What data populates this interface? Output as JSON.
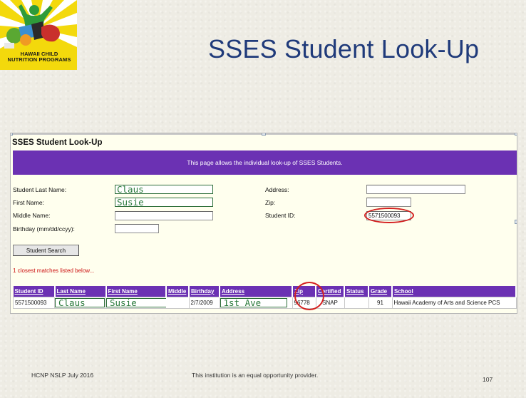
{
  "logo": {
    "line1": "HAWAII CHILD",
    "line2": "NUTRITION PROGRAMS",
    "colors": {
      "sun": "#f3d90c",
      "figure": "#2e9b3a",
      "burst": "#ffffff"
    }
  },
  "slide": {
    "title": "SSES Student Look-Up",
    "title_color": "#1f3a7a"
  },
  "screen": {
    "title": "SSES Student Look-Up",
    "banner_text": "This page allows the individual look-up of SSES Students.",
    "banner_color": "#6b31b3",
    "form": {
      "last_name_label": "Student Last Name:",
      "last_name_value": "Claus",
      "first_name_label": "First Name:",
      "first_name_value": "Susie",
      "middle_name_label": "Middle Name:",
      "middle_name_value": "",
      "birthday_label": "Birthday (mm/dd/ccyy):",
      "birthday_value": "",
      "address_label": "Address:",
      "address_value": "",
      "zip_label": "Zip:",
      "zip_value": "",
      "student_id_label": "Student ID:",
      "student_id_value": "5571500093"
    },
    "search_button": "Student Search",
    "matches_text": "1 closest matches listed below...",
    "results": {
      "columns": [
        "Student ID",
        "Last Name",
        "First Name",
        "Middle",
        "Birthday",
        "Address",
        "Zip",
        "Certified",
        "Status",
        "Grade",
        "School"
      ],
      "rows": [
        [
          "5571500093",
          "Claus",
          "Susie",
          "",
          "2/7/2009",
          "1st Ave",
          "96778",
          "SNAP",
          "",
          "91",
          "Hawaii Academy of Arts and Science PCS"
        ]
      ]
    },
    "highlight_color": "#d42020"
  },
  "footer": {
    "left": "HCNP NSLP July 2016",
    "center": "This institution is an equal opportunity provider.",
    "page_number": "107"
  }
}
